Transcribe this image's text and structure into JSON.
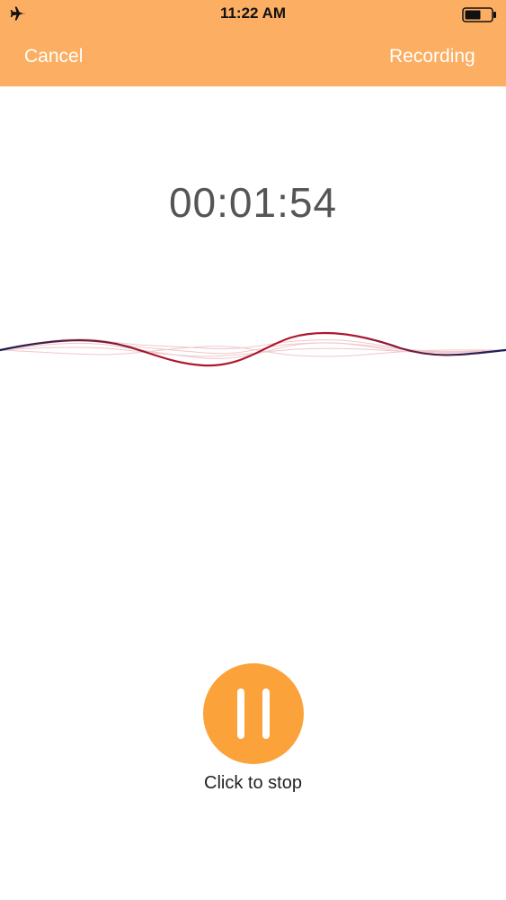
{
  "status_bar": {
    "time": "11:22 AM",
    "icons": [
      "airplane-icon",
      "battery-icon"
    ]
  },
  "nav": {
    "cancel_label": "Cancel",
    "title": "Recording"
  },
  "timer": {
    "elapsed": "00:01:54"
  },
  "controls": {
    "pause_icon": "pause-icon",
    "stop_label": "Click to stop"
  },
  "colors": {
    "header_background": "#fcae62",
    "button_background": "#fba23a",
    "wave_primary": "#b0162c",
    "wave_secondary": "#1a1d55"
  }
}
